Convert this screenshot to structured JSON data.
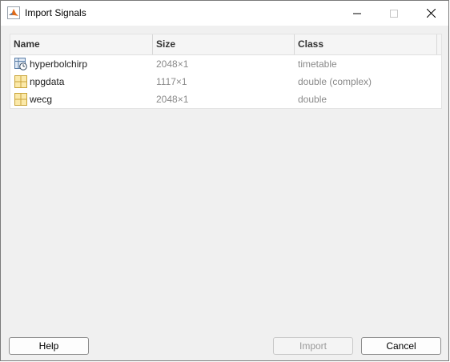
{
  "window": {
    "title": "Import Signals",
    "controls": {
      "minimize_icon": "minimize-icon",
      "maximize_icon": "maximize-icon",
      "close_icon": "close-icon"
    }
  },
  "table": {
    "columns": [
      "Name",
      "Size",
      "Class"
    ],
    "rows": [
      {
        "name": "hyperbolchirp",
        "size": "2048×1",
        "class": "timetable",
        "icon": "timetable-icon"
      },
      {
        "name": "npgdata",
        "size": "1117×1",
        "class": "double (complex)",
        "icon": "matrix-variable-icon"
      },
      {
        "name": "wecg",
        "size": "2048×1",
        "class": "double",
        "icon": "matrix-variable-icon"
      }
    ]
  },
  "buttons": {
    "help": "Help",
    "import": "Import",
    "cancel": "Cancel"
  },
  "colors": {
    "background": "#f0f0f0",
    "table_bg": "#ffffff",
    "disabled_text": "#9a9a9a",
    "secondary_text": "#8a8a8a"
  }
}
